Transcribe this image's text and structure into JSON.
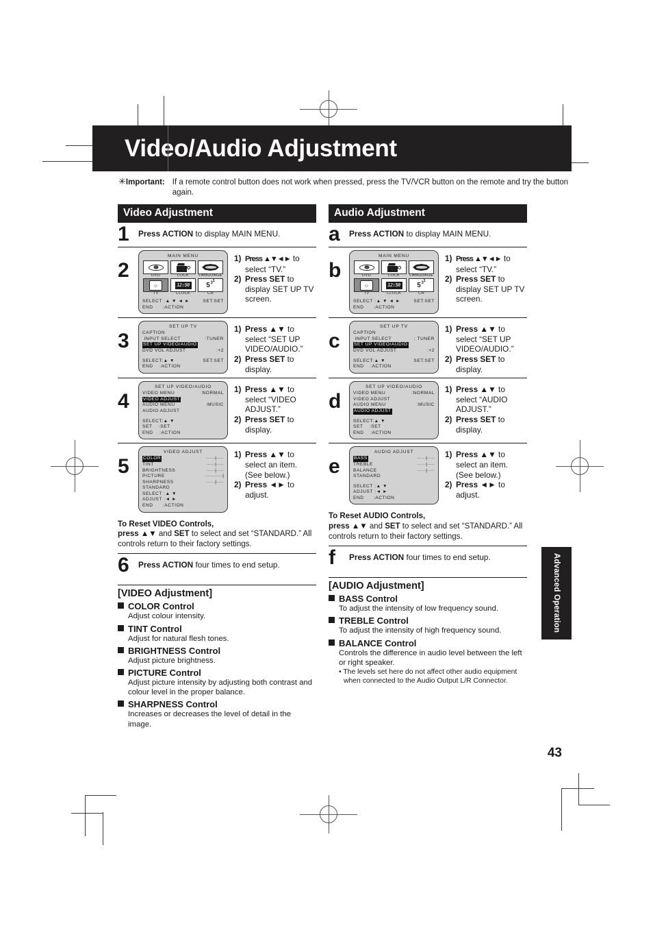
{
  "page": {
    "title": "Video/Audio Adjustment",
    "number": "43",
    "side_tab": "Advanced Operation"
  },
  "important": {
    "star": "✶",
    "label": "Important:",
    "text": "If a remote control button does not work when pressed, press the TV/VCR button on the remote and try the button again."
  },
  "video_section": {
    "heading": "Video Adjustment",
    "step1": {
      "num": "1",
      "text_bold": "Press ACTION",
      "text_rest": " to display MAIN MENU."
    },
    "step2": {
      "num": "2",
      "osd": {
        "title": "MAIN MENU",
        "items": [
          {
            "icon": "disc-icon",
            "label": "DVD",
            "selected": false
          },
          {
            "icon": "lock-icon",
            "label": "LOCK",
            "selected": false
          },
          {
            "icon": "language-icon",
            "label": "LANGUAGE",
            "selected": false
          },
          {
            "icon": "tv-icon",
            "label": "TV",
            "selected": true
          },
          {
            "icon": "clock-icon",
            "label": "CLOCK",
            "selected": false
          },
          {
            "icon": "channel-icon",
            "label": "CH",
            "selected": false
          }
        ],
        "clock_value": "12:50",
        "channel_value": "5",
        "channel_sup1": "3",
        "channel_sup2": "1",
        "footer_left": "SELECT :▲ ▼ ◄ ►",
        "footer_right": "SET:SET",
        "footer_end": "END      :ACTION"
      },
      "instructions": [
        {
          "num": "1)",
          "bold": "Press ▲▼◄►",
          "rest": " to select “TV.”"
        },
        {
          "num": "2)",
          "bold": "Press SET",
          "rest": " to display SET UP TV screen."
        }
      ]
    },
    "step3": {
      "num": "3",
      "osd": {
        "title": "SET UP TV",
        "lines": [
          {
            "text": "CAPTION",
            "value": "",
            "highlight": false
          },
          {
            "text": " INPUT SELECT",
            "value": ":TUNER",
            "highlight": false
          },
          {
            "text": "SET UP VIDEO/AUDIO",
            "value": "",
            "highlight": true
          },
          {
            "text": "DVD VOL ADJUST",
            "value": ":+2",
            "highlight": false
          }
        ],
        "footer_left": "SELECT:▲ ▼",
        "footer_right": "SET:SET",
        "footer_end": "END    :ACTION"
      },
      "instructions": [
        {
          "num": "1)",
          "bold": "Press ▲▼",
          "rest": " to select “SET UP VIDEO/AUDIO.”"
        },
        {
          "num": "2)",
          "bold": "Press SET",
          "rest": " to display."
        }
      ]
    },
    "step4": {
      "num": "4",
      "osd": {
        "title": "SET UP VIDEO/AUDIO",
        "lines": [
          {
            "text": "VIDEO MENU",
            "value": ":NORMAL",
            "highlight": false
          },
          {
            "text": "VIDEO ADJUST",
            "value": "",
            "highlight": true
          },
          {
            "text": "AUDIO MENU",
            "value": ":MUSIC",
            "highlight": false
          },
          {
            "text": "AUDIO ADJUST",
            "value": "",
            "highlight": false
          }
        ],
        "footer_l1": "SELECT:▲ ▼",
        "footer_l2": "SET    :SET",
        "footer_l3": "END    :ACTION"
      },
      "instructions": [
        {
          "num": "1)",
          "bold": "Press ▲▼",
          "rest": " to select “VIDEO ADJUST.”"
        },
        {
          "num": "2)",
          "bold": "Press SET",
          "rest": " to display."
        }
      ]
    },
    "step5": {
      "num": "5",
      "osd": {
        "title": "VIDEO ADJUST",
        "lines": [
          {
            "text": "COLOR",
            "bar": "······|·····",
            "highlight": true
          },
          {
            "text": "TINT",
            "bar": "······|·····",
            "highlight": false
          },
          {
            "text": "BRIGHTNESS",
            "bar": "······|·····",
            "highlight": false
          },
          {
            "text": "PICTURE",
            "bar": "············|",
            "highlight": false
          },
          {
            "text": "SHARPNESS",
            "bar": "······|·····",
            "highlight": false
          },
          {
            "text": "STANDARD",
            "bar": "",
            "highlight": false
          }
        ],
        "footer_l1": "SELECT :▲ ▼",
        "footer_l2": "ADJUST :◄ ►",
        "footer_l3": "END      :ACTION"
      },
      "instructions": [
        {
          "num": "1)",
          "bold": "Press ▲▼",
          "rest": " to select an item. (See below.)"
        },
        {
          "num": "2)",
          "bold": "Press ◄►",
          "rest": " to adjust."
        }
      ]
    },
    "reset": {
      "heading": "To Reset VIDEO Controls,",
      "bold1": "press ▲▼",
      "mid": " and ",
      "bold2": "SET",
      "rest": " to select and set “STANDARD.” All controls return to their factory settings."
    },
    "step6": {
      "num": "6",
      "text_bold": "Press ACTION",
      "text_rest": " four times to end setup."
    },
    "deflist": {
      "title": "[VIDEO Adjustment]",
      "items": [
        {
          "head": "COLOR Control",
          "body": "Adjust colour intensity."
        },
        {
          "head": "TINT Control",
          "body": "Adjust for natural flesh tones."
        },
        {
          "head": "BRIGHTNESS Control",
          "body": "Adjust picture brightness."
        },
        {
          "head": "PICTURE Control",
          "body": "Adjust picture intensity by adjusting both contrast and colour level in the proper balance."
        },
        {
          "head": "SHARPNESS Control",
          "body": "Increases or decreases the level of detail in the image."
        }
      ]
    }
  },
  "audio_section": {
    "heading": "Audio Adjustment",
    "stepa": {
      "num": "a",
      "text_bold": "Press ACTION",
      "text_rest": " to display MAIN MENU."
    },
    "stepb": {
      "num": "b",
      "osd": {
        "title": "MAIN MENU",
        "items": [
          {
            "icon": "disc-icon",
            "label": "DVD",
            "selected": false
          },
          {
            "icon": "lock-icon",
            "label": "LOCK",
            "selected": false
          },
          {
            "icon": "language-icon",
            "label": "LANGUAGE",
            "selected": false
          },
          {
            "icon": "tv-icon",
            "label": "TV",
            "selected": true
          },
          {
            "icon": "clock-icon",
            "label": "CLOCK",
            "selected": false
          },
          {
            "icon": "channel-icon",
            "label": "CH",
            "selected": false
          }
        ],
        "clock_value": "12:50",
        "channel_value": "5",
        "channel_sup1": "3",
        "channel_sup2": "1",
        "footer_left": "SELECT :▲ ▼ ◄ ►",
        "footer_right": "SET:SET",
        "footer_end": "END      :ACTION"
      },
      "instructions": [
        {
          "num": "1)",
          "bold": "Press ▲▼◄►",
          "rest": " to select “TV.”"
        },
        {
          "num": "2)",
          "bold": "Press SET",
          "rest": " to display SET UP TV screen."
        }
      ]
    },
    "stepc": {
      "num": "c",
      "osd": {
        "title": "SET UP TV",
        "lines": [
          {
            "text": "CAPTION",
            "value": "",
            "highlight": false
          },
          {
            "text": " INPUT SELECT",
            "value": ": TUNER",
            "highlight": false
          },
          {
            "text": "SET UP VIDEO/AUDIO",
            "value": "",
            "highlight": true
          },
          {
            "text": "DVD VOL ADJUST",
            "value": ":+2",
            "highlight": false
          }
        ],
        "footer_left": "SELECT:▲ ▼",
        "footer_right": "SET:SET",
        "footer_end": "END    :ACTION"
      },
      "instructions": [
        {
          "num": "1)",
          "bold": "Press ▲▼",
          "rest": " to select “SET UP VIDEO/AUDIO.”"
        },
        {
          "num": "2)",
          "bold": "Press SET",
          "rest": " to display."
        }
      ]
    },
    "stepd": {
      "num": "d",
      "osd": {
        "title": "SET UP VIDEO/AUDIO",
        "lines": [
          {
            "text": "VIDEO MENU",
            "value": ":NORMAL",
            "highlight": false
          },
          {
            "text": "VIDEO ADJUST",
            "value": "",
            "highlight": false
          },
          {
            "text": "AUDIO MENU",
            "value": ":MUSIC",
            "highlight": false
          },
          {
            "text": "AUDIO ADJUST",
            "value": "",
            "highlight": true
          }
        ],
        "footer_l1": "SELECT:▲ ▼",
        "footer_l2": "SET    :SET",
        "footer_l3": "END    :ACTION"
      },
      "instructions": [
        {
          "num": "1)",
          "bold": "Press ▲▼",
          "rest": " to select “AUDIO ADJUST.”"
        },
        {
          "num": "2)",
          "bold": "Press SET",
          "rest": " to display."
        }
      ]
    },
    "stepe": {
      "num": "e",
      "osd": {
        "title": "AUDIO ADJUST",
        "lines": [
          {
            "text": "BASS",
            "bar": "······|·····",
            "highlight": true
          },
          {
            "text": "TREBLE",
            "bar": "······|·····",
            "highlight": false
          },
          {
            "text": "BALANCE",
            "bar": "······|·····",
            "highlight": false
          },
          {
            "text": "STANDARD",
            "bar": "",
            "highlight": false
          }
        ],
        "footer_l1": "SELECT :▲ ▼",
        "footer_l2": "ADJUST :◄ ►",
        "footer_l3": "END      :ACTION"
      },
      "instructions": [
        {
          "num": "1)",
          "bold": "Press ▲▼",
          "rest": " to select an item. (See below.)"
        },
        {
          "num": "2)",
          "bold": "Press ◄►",
          "rest": " to adjust."
        }
      ]
    },
    "reset": {
      "heading": "To Reset AUDIO Controls,",
      "bold1": "press ▲▼",
      "mid": " and ",
      "bold2": "SET",
      "rest": " to select and set “STANDARD.” All controls return to their factory settings."
    },
    "stepf": {
      "num": "f",
      "text_bold": "Press ACTION",
      "text_rest": " four times to end setup."
    },
    "deflist": {
      "title": "[AUDIO Adjustment]",
      "items": [
        {
          "head": "BASS Control",
          "body": "To adjust the intensity of low frequency sound."
        },
        {
          "head": "TREBLE Control",
          "body": "To adjust the intensity of high frequency sound."
        },
        {
          "head": "BALANCE Control",
          "body": "Controls the difference in audio level between the left or right speaker."
        }
      ],
      "subnote": "• The levels set here do not affect other audio equipment when connected to the Audio Output L/R Connector."
    }
  },
  "colors": {
    "banner_bg": "#221f20",
    "osd_bg": "#d2d2d2",
    "highlight_bg": "#111111",
    "text": "#1a1a1a"
  }
}
